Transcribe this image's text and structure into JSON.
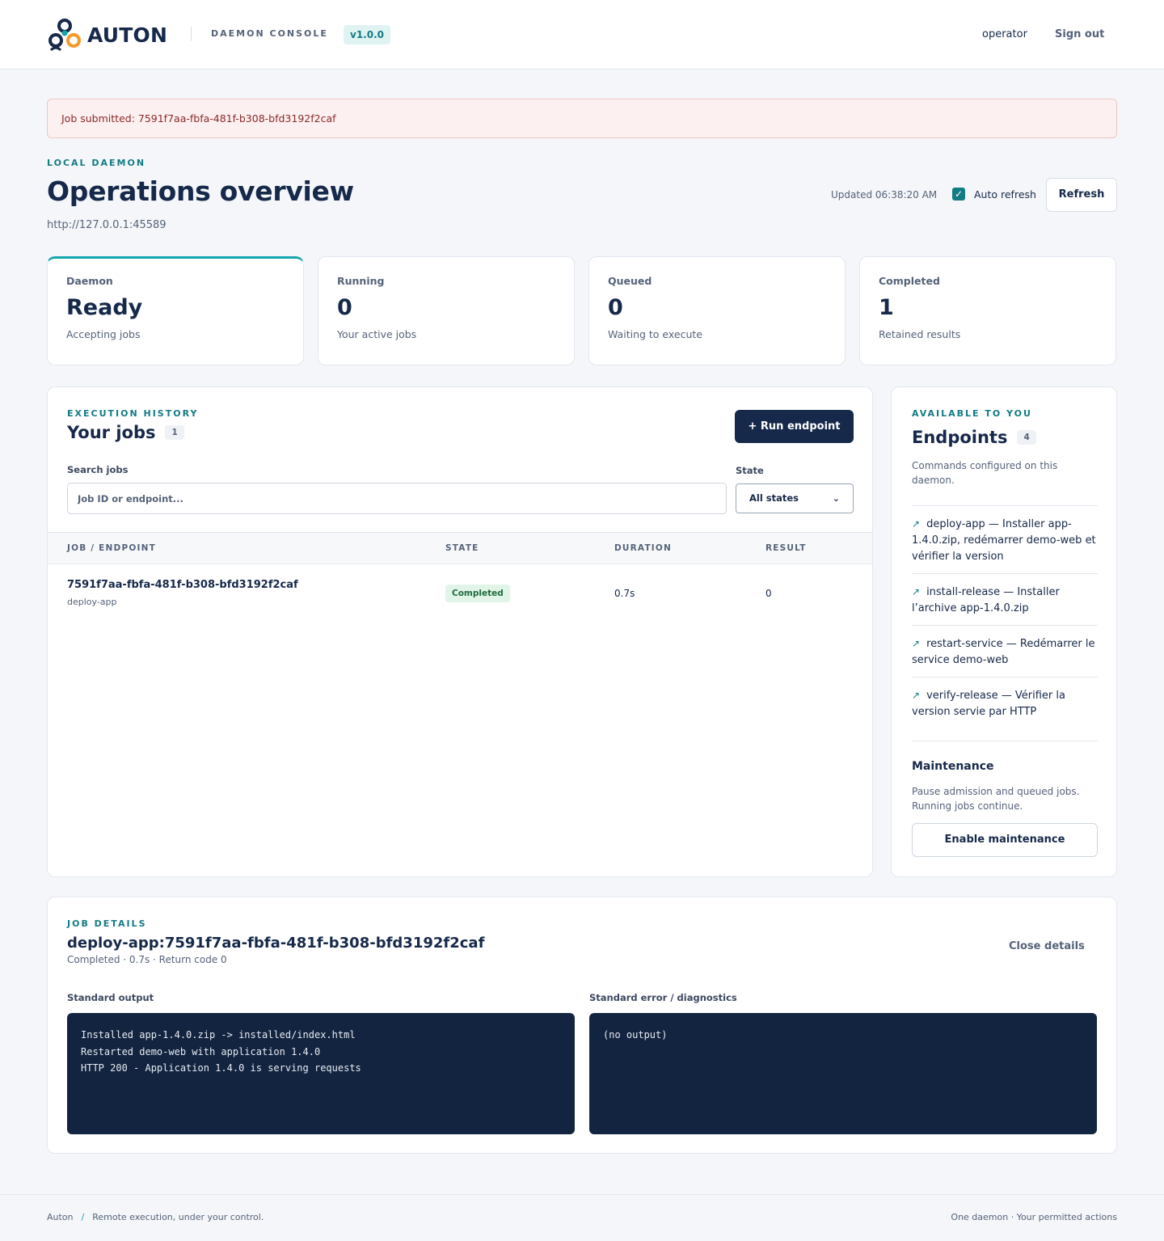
{
  "header": {
    "brand": "AUTON",
    "console_label": "DAEMON CONSOLE",
    "version": "v1.0.0",
    "user": "operator",
    "signout_label": "Sign out"
  },
  "alert": {
    "message": "Job submitted: 7591f7aa-fbfa-481f-b308-bfd3192f2caf"
  },
  "page": {
    "eyebrow": "LOCAL DAEMON",
    "title": "Operations overview",
    "url": "http://127.0.0.1:45589",
    "updated": "Updated 06:38:20 AM",
    "auto_refresh_label": "Auto refresh",
    "auto_refresh_checked": true,
    "refresh_label": "Refresh"
  },
  "stats": [
    {
      "label": "Daemon",
      "value": "Ready",
      "sub": "Accepting jobs"
    },
    {
      "label": "Running",
      "value": "0",
      "sub": "Your active jobs"
    },
    {
      "label": "Queued",
      "value": "0",
      "sub": "Waiting to execute"
    },
    {
      "label": "Completed",
      "value": "1",
      "sub": "Retained results"
    }
  ],
  "jobs": {
    "eyebrow": "EXECUTION HISTORY",
    "title": "Your jobs",
    "count": "1",
    "run_label": "+ Run endpoint",
    "search_label": "Search jobs",
    "search_placeholder": "Job ID or endpoint...",
    "search_value": "",
    "state_label": "State",
    "state_value": "All states",
    "columns": [
      "JOB / ENDPOINT",
      "STATE",
      "DURATION",
      "RESULT"
    ],
    "rows": [
      {
        "job_id": "7591f7aa-fbfa-481f-b308-bfd3192f2caf",
        "endpoint": "deploy-app",
        "state": "Completed",
        "duration": "0.7s",
        "result": "0"
      }
    ]
  },
  "endpoints": {
    "eyebrow": "AVAILABLE TO YOU",
    "title": "Endpoints",
    "count": "4",
    "subtitle": "Commands configured on this daemon.",
    "items": [
      {
        "icon": "arrow-up-right-icon",
        "text": "deploy-app — Installer app-1.4.0.zip, redémarrer demo-web et vérifier la version"
      },
      {
        "icon": "arrow-up-right-icon",
        "text": "install-release — Installer l’archive app-1.4.0.zip"
      },
      {
        "icon": "arrow-up-right-icon",
        "text": "restart-service — Redémarrer le service demo-web"
      },
      {
        "icon": "arrow-up-right-icon",
        "text": "verify-release — Vérifier la version servie par HTTP"
      }
    ],
    "maintenance_title": "Maintenance",
    "maintenance_sub": "Pause admission and queued jobs. Running jobs continue.",
    "maintenance_button": "Enable maintenance"
  },
  "details": {
    "eyebrow": "JOB DETAILS",
    "title": "deploy-app:7591f7aa-fbfa-481f-b308-bfd3192f2caf",
    "subtitle": "Completed · 0.7s · Return code 0",
    "close_label": "Close details",
    "stdout_label": "Standard output",
    "stdout": "Installed app-1.4.0.zip -> installed/index.html\nRestarted demo-web with application 1.4.0\nHTTP 200 - Application 1.4.0 is serving requests",
    "stderr_label": "Standard error / diagnostics",
    "stderr": "(no output)"
  },
  "footer": {
    "brand": "Auton",
    "separator": "/",
    "tagline": "Remote execution, under your control.",
    "right": "One daemon · Your permitted actions"
  },
  "colors": {
    "navy": "#16294a",
    "teal": "#137b83",
    "accent": "#14a6ae",
    "orange": "#f39a2b",
    "success_bg": "#e1f4e8",
    "alert_bg": "#fdf0f0"
  }
}
